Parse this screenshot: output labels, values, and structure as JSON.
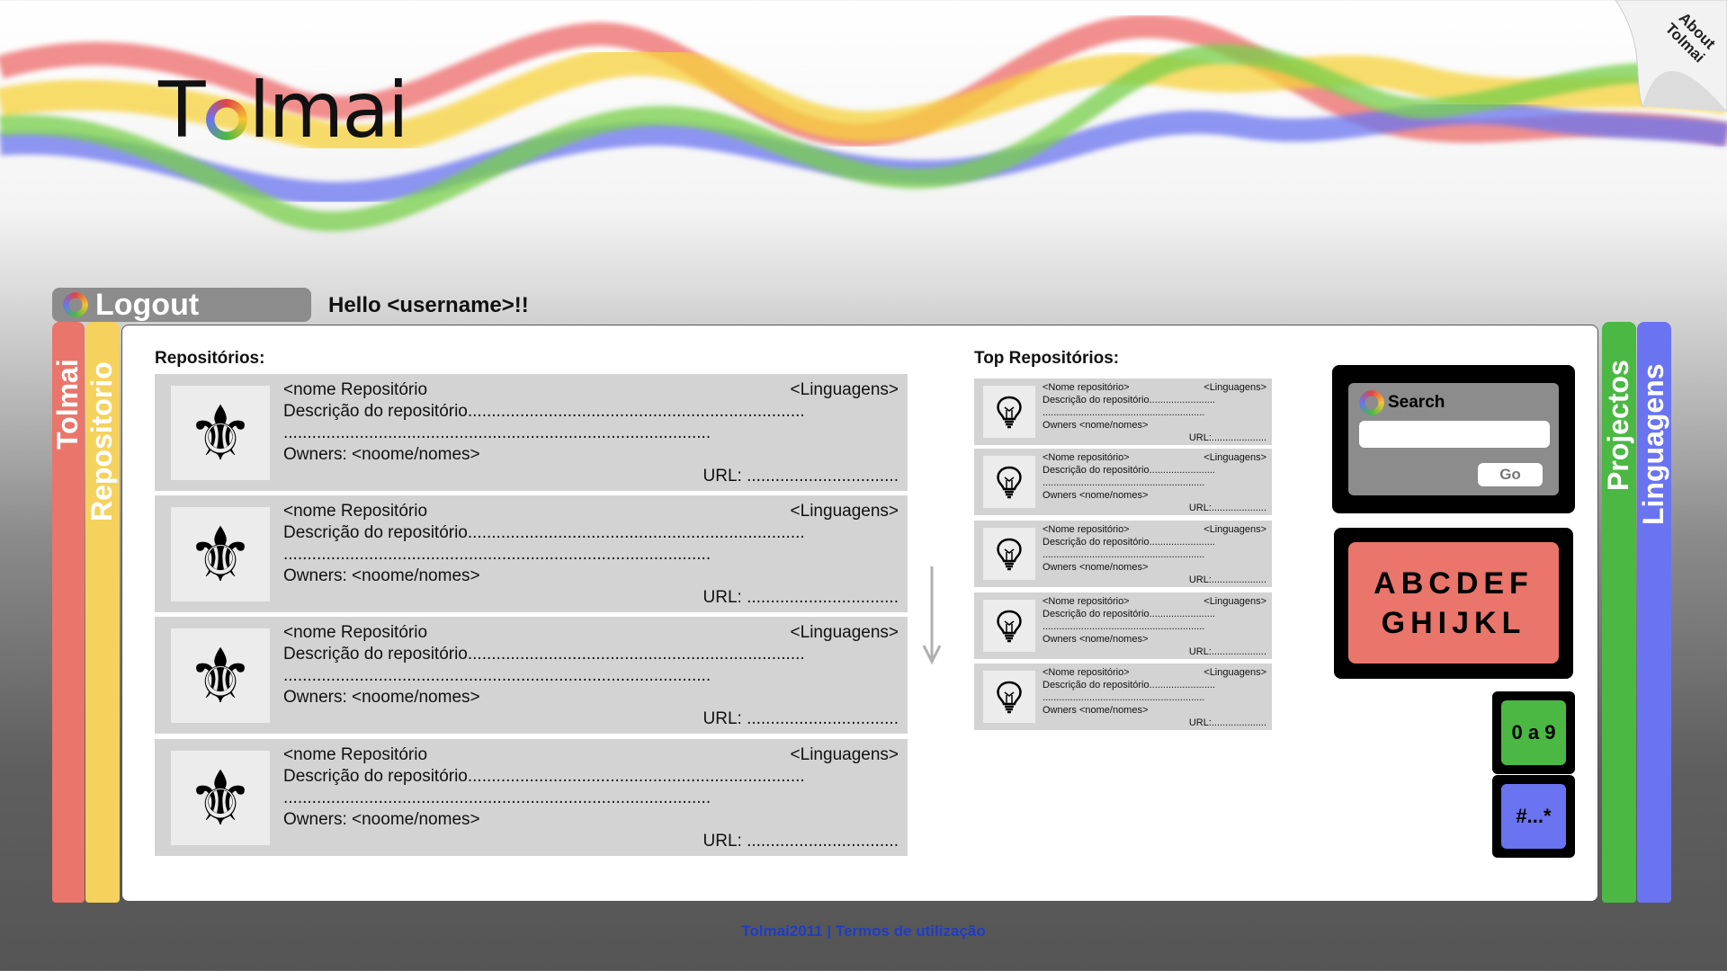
{
  "brand": {
    "logo_prefix": "T",
    "logo_suffix": "lmai"
  },
  "about": {
    "line1": "About",
    "line2": "Tolmai"
  },
  "header": {
    "logout_label": "Logout",
    "greeting": "Hello <username>!!"
  },
  "left_tabs": [
    {
      "label": "Tolmai",
      "color": "#e9756b"
    },
    {
      "label": "Repositorio",
      "color": "#f5d25e"
    }
  ],
  "right_tabs": [
    {
      "label": "Projectos",
      "color": "#4cb844"
    },
    {
      "label": "Linguagens",
      "color": "#6a74f0"
    }
  ],
  "repositories": {
    "title": "Repositórios:",
    "items": [
      {
        "name": "<nome Repositório",
        "languages": "<Linguagens>",
        "description": "Descrição do repositório.......................................................................",
        "dots": "..........................................................................................",
        "owners": "Owners: <noome/nomes>",
        "url": "URL: ................................"
      },
      {
        "name": "<nome Repositório",
        "languages": "<Linguagens>",
        "description": "Descrição do repositório.......................................................................",
        "dots": "..........................................................................................",
        "owners": "Owners: <noome/nomes>",
        "url": "URL: ................................"
      },
      {
        "name": "<nome Repositório",
        "languages": "<Linguagens>",
        "description": "Descrição do repositório.......................................................................",
        "dots": "..........................................................................................",
        "owners": "Owners: <noome/nomes>",
        "url": "URL: ................................"
      },
      {
        "name": "<nome Repositório",
        "languages": "<Linguagens>",
        "description": "Descrição do repositório.......................................................................",
        "dots": "..........................................................................................",
        "owners": "Owners: <noome/nomes>",
        "url": "URL: ................................"
      }
    ]
  },
  "top_repositories": {
    "title": "Top Repositórios:",
    "items": [
      {
        "name": "<Nome repositório>",
        "languages": "<Linguagens>",
        "description": "Descrição do repositório........................",
        "dots": "...........................................................",
        "owners": "Owners <nome/nomes>",
        "url": "URL:...................."
      },
      {
        "name": "<Nome repositório>",
        "languages": "<Linguagens>",
        "description": "Descrição do repositório........................",
        "dots": "...........................................................",
        "owners": "Owners <nome/nomes>",
        "url": "URL:...................."
      },
      {
        "name": "<Nome repositório>",
        "languages": "<Linguagens>",
        "description": "Descrição do repositório........................",
        "dots": "...........................................................",
        "owners": "Owners <nome/nomes>",
        "url": "URL:...................."
      },
      {
        "name": "<Nome repositório>",
        "languages": "<Linguagens>",
        "description": "Descrição do repositório........................",
        "dots": "...........................................................",
        "owners": "Owners <nome/nomes>",
        "url": "URL:...................."
      },
      {
        "name": "<Nome repositório>",
        "languages": "<Linguagens>",
        "description": "Descrição do repositório........................",
        "dots": "...........................................................",
        "owners": "Owners <nome/nomes>",
        "url": "URL:...................."
      }
    ]
  },
  "search": {
    "label": "Search",
    "value": "",
    "go_label": "Go"
  },
  "alphabet": {
    "row1": "ABCDEF",
    "row2": "GHIJKL"
  },
  "filters": {
    "digits_label": "0 a 9",
    "symbols_label": "#...*"
  },
  "footer": {
    "text": "Tolmai2011 | Termos de utilização"
  },
  "icons": {
    "repo": "fleur-de-lis-icon",
    "top_repo": "lightbulb-icon",
    "scroll": "down-arrow-icon"
  },
  "colors": {
    "red": "#e9756b",
    "yellow": "#f5d25e",
    "green": "#4cb844",
    "blue": "#6a74f0",
    "link": "#1e3cc9"
  }
}
